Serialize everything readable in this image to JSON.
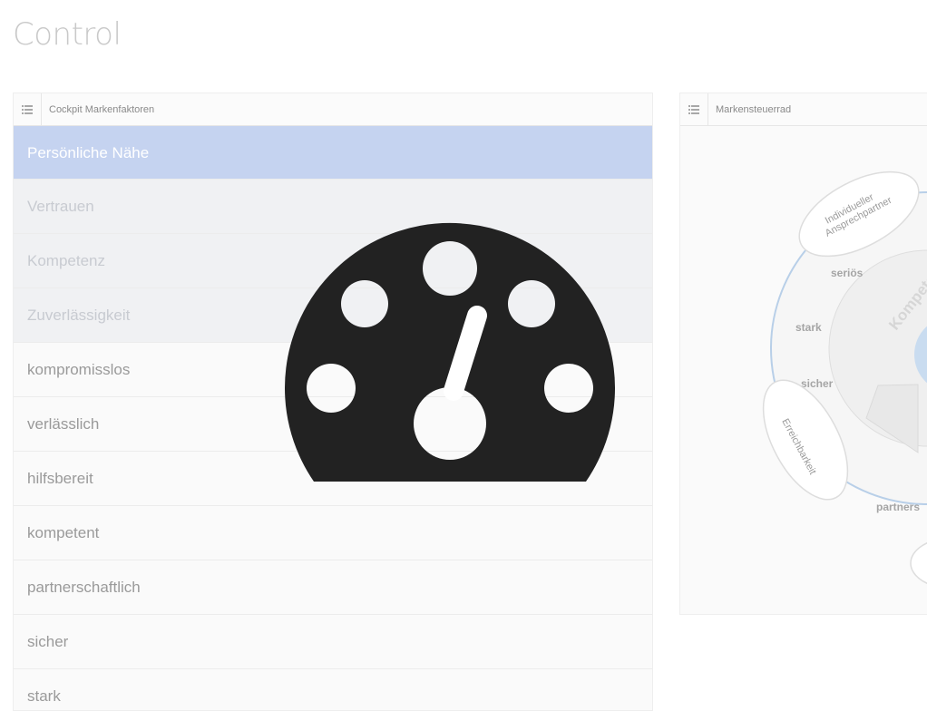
{
  "page": {
    "title": "Control"
  },
  "left_panel": {
    "title": "Cockpit Markenfaktoren",
    "active_item": "Persönliche Nähe",
    "factors": [
      "Vertrauen",
      "Kompetenz",
      "Zuverlässigkeit"
    ],
    "attributes": [
      "kompromisslos",
      "verlässlich",
      "hilfsbereit",
      "kompetent",
      "partnerschaftlich",
      "sicher",
      "stark"
    ]
  },
  "right_panel": {
    "title": "Markensteuerrad",
    "wheel": {
      "bubble_top_line1": "Individueller",
      "bubble_top_line2": "Ansprechpartner",
      "bubble_left": "Erreichbarkeit",
      "ring_label": "Kompete",
      "words": [
        "seriös",
        "stark",
        "sicher",
        "partners"
      ]
    }
  },
  "icons": {
    "list": "list-icon",
    "overlay": "dashboard-gauge-icon"
  },
  "colors": {
    "active": "#c5d3f0",
    "overlay": "#222222",
    "ring": "#b8cfe8"
  }
}
